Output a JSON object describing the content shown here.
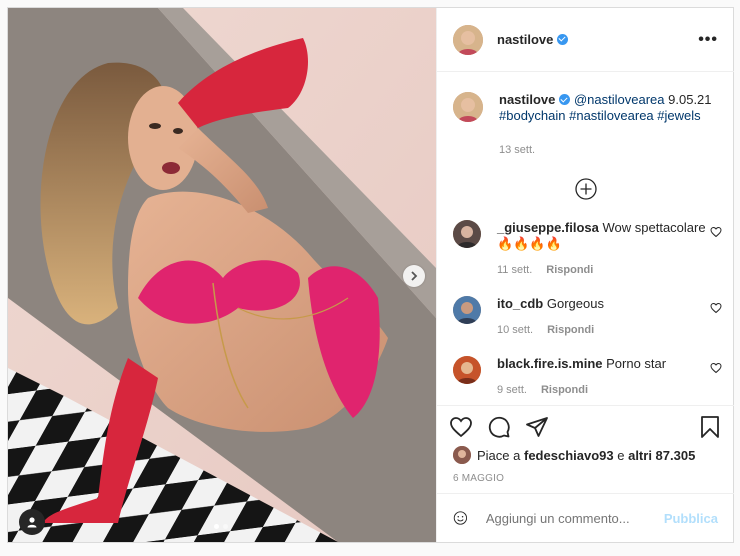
{
  "post": {
    "username": "nastilove",
    "more_icon": "•••",
    "caption": {
      "username": "nastilove",
      "mention": "@nastilovearea",
      "date_text": "9.05.21",
      "hashtags": "#bodychain #nastilovearea #jewels",
      "time": "13 sett."
    },
    "load_more_icon": "plus-circle-icon",
    "comments": [
      {
        "username": "_giuseppe.filosa",
        "text": "Wow spettacolare 🔥🔥🔥🔥",
        "time": "11 sett.",
        "reply": "Rispondi"
      },
      {
        "username": "ito_cdb",
        "text": "Gorgeous",
        "time": "10 sett.",
        "reply": "Rispondi"
      },
      {
        "username": "black.fire.is.mine",
        "text": "Porno star",
        "time": "9 sett.",
        "reply": "Rispondi"
      }
    ],
    "likes": {
      "prefix": "Piace a",
      "user": "fedeschiavo93",
      "middle": "e",
      "others": "altri 87.305"
    },
    "date": "6 MAGGIO",
    "add_comment": {
      "placeholder": "Aggiungi un commento...",
      "publish": "Pubblica"
    }
  },
  "colors": {
    "accent": "#3897f0",
    "link": "#00376b",
    "muted": "#8e8e8e",
    "publish_disabled": "#b2dffc"
  }
}
